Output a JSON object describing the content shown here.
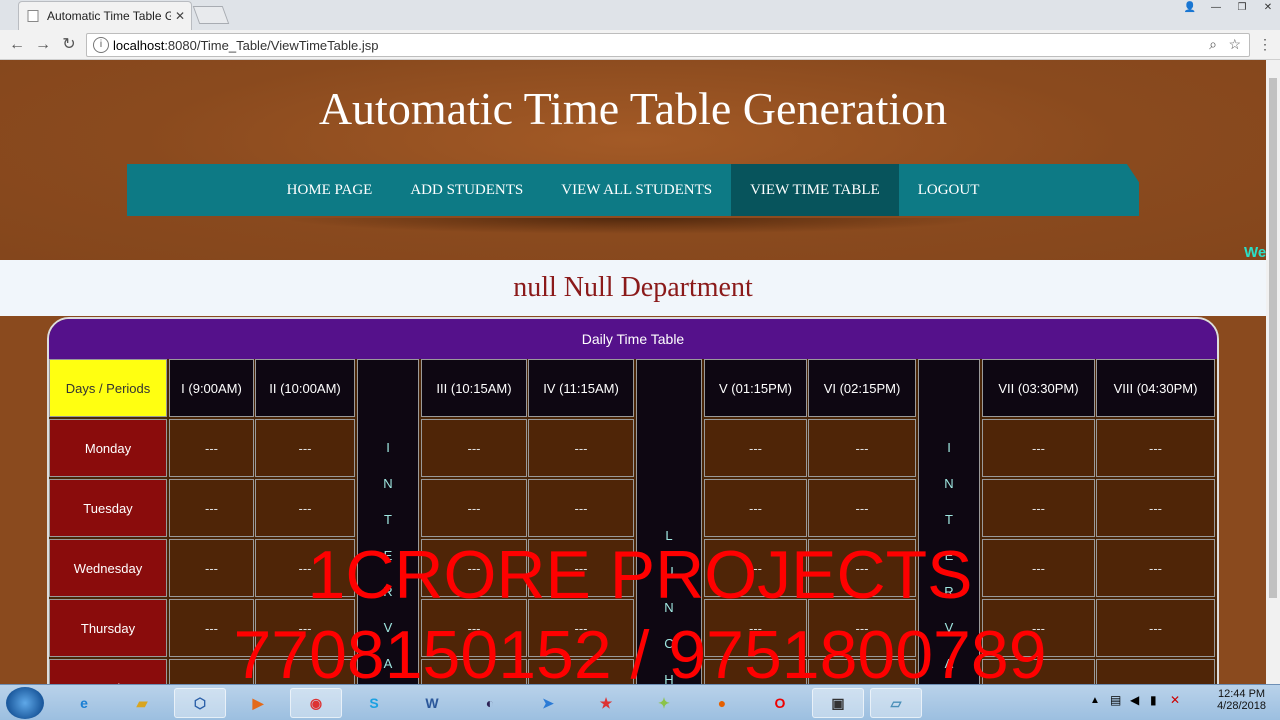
{
  "browser": {
    "tab_title": "Automatic Time Table Ge",
    "url_host": "localhost",
    "url_rest": ":8080/Time_Table/ViewTimeTable.jsp"
  },
  "site": {
    "title": "Automatic Time Table Generation",
    "nav": [
      "HOME PAGE",
      "ADD STUDENTS",
      "VIEW ALL STUDENTS",
      "VIEW TIME TABLE",
      "LOGOUT"
    ],
    "active_nav": "VIEW TIME TABLE",
    "marquee": "We"
  },
  "department": "null Null Department",
  "timetable": {
    "caption": "Daily Time Table",
    "corner": "Days / Periods",
    "periods": [
      "I (9:00AM)",
      "II (10:00AM)",
      "III (10:15AM)",
      "IV (11:15AM)",
      "V (01:15PM)",
      "VI (02:15PM)",
      "VII (03:30PM)",
      "VIII (04:30PM)"
    ],
    "days": [
      "Monday",
      "Tuesday",
      "Wednesday",
      "Thursday",
      "Saturday"
    ],
    "empty": "---",
    "interval": "INTERVAL",
    "lunch": "LUNCH"
  },
  "watermark": {
    "line1": "1CRORE PROJECTS",
    "line2": "7708150152 / 9751800789"
  },
  "taskbar": {
    "time": "12:44 PM",
    "date": "4/28/2018"
  }
}
